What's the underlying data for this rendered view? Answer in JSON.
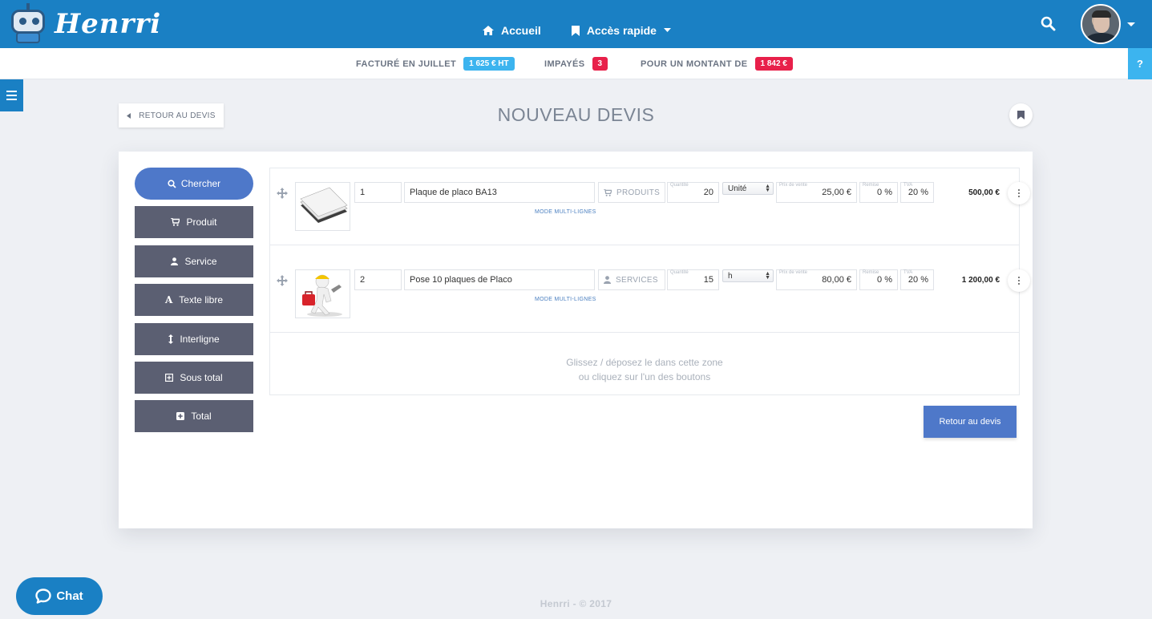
{
  "brand": {
    "name": "Henrri"
  },
  "nav": {
    "home_label": "Accueil",
    "quick_access_label": "Accès rapide"
  },
  "stats": {
    "billed_label": "FACTURÉ EN JUILLET",
    "billed_value": "1 625 € HT",
    "unpaid_label": "IMPAYÉS",
    "unpaid_value": "3",
    "amount_label": "POUR UN MONTANT DE",
    "amount_value": "1 842 €",
    "colors": {
      "billed": "#3cb4ef",
      "unpaid": "#e8204a",
      "amount": "#e8204a"
    }
  },
  "help_label": "?",
  "header": {
    "back_label": "RETOUR AU DEVIS",
    "title": "NOUVEAU DEVIS"
  },
  "sidebar": {
    "search_label": "Chercher",
    "items": [
      {
        "label": "Produit",
        "icon": "cart-icon"
      },
      {
        "label": "Service",
        "icon": "user-icon"
      },
      {
        "label": "Texte libre",
        "icon": "text-icon"
      },
      {
        "label": "Interligne",
        "icon": "line-height-icon"
      },
      {
        "label": "Sous total",
        "icon": "plus-square-outline-icon"
      },
      {
        "label": "Total",
        "icon": "plus-square-icon"
      }
    ]
  },
  "field_labels": {
    "quantity": "Quantité",
    "price": "Prix de vente",
    "discount": "Remise",
    "vat": "TVA"
  },
  "lines": [
    {
      "ref": "1",
      "designation": "Plaque de placo BA13",
      "category": "PRODUITS",
      "quantity": "20",
      "unit": "Unité",
      "price": "25,00 €",
      "discount": "0 %",
      "vat": "20 %",
      "total": "500,00 €",
      "mode_label": "MODE MULTI-LIGNES"
    },
    {
      "ref": "2",
      "designation": "Pose 10 plaques de Placo",
      "category": "SERVICES",
      "quantity": "15",
      "unit": "h",
      "price": "80,00 €",
      "discount": "0 %",
      "vat": "20 %",
      "total": "1 200,00 €",
      "mode_label": "MODE MULTI-LIGNES"
    }
  ],
  "dropzone": {
    "line1": "Glissez / déposez le dans cette zone",
    "line2": "ou cliquez sur l'un des boutons"
  },
  "back_button_label": "Retour au devis",
  "chat_label": "Chat",
  "footer": "Henrri - © 2017"
}
